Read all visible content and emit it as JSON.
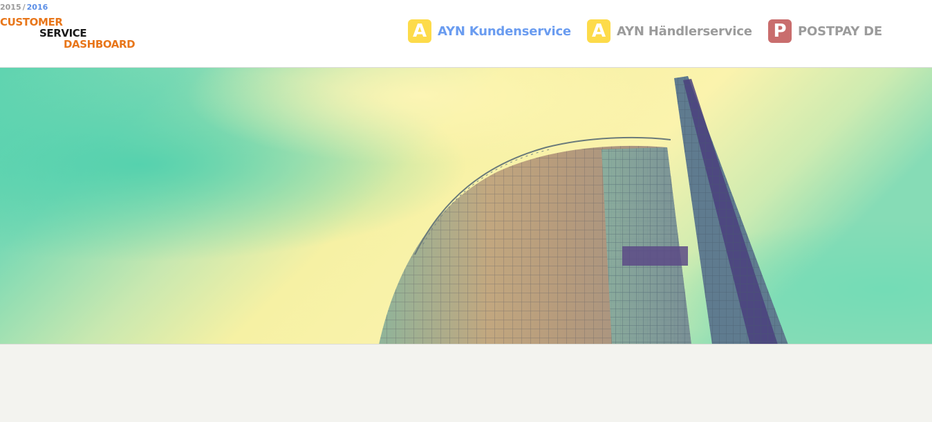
{
  "logo": {
    "year_old": "2015",
    "year_sep": "/",
    "year_new": "2016",
    "line1": "CUSTOMER",
    "line2": "SERVICE",
    "line3": "DASHBOARD"
  },
  "nav": {
    "items": [
      {
        "badge": "A",
        "label": "AYN Kundenservice",
        "active": true
      },
      {
        "badge": "A",
        "label": "AYN Händlerservice",
        "active": false
      },
      {
        "badge": "P",
        "label": "POSTPAY DE",
        "active": false
      }
    ]
  },
  "colors": {
    "accent_orange": "#e8761a",
    "active_blue": "#6a9cf0",
    "badge_yellow": "#fddb4a",
    "badge_red": "#c96d6d",
    "inactive_gray": "#9b9b9b"
  },
  "hero": {
    "image_subject": "office tower against teal and yellow sky"
  }
}
